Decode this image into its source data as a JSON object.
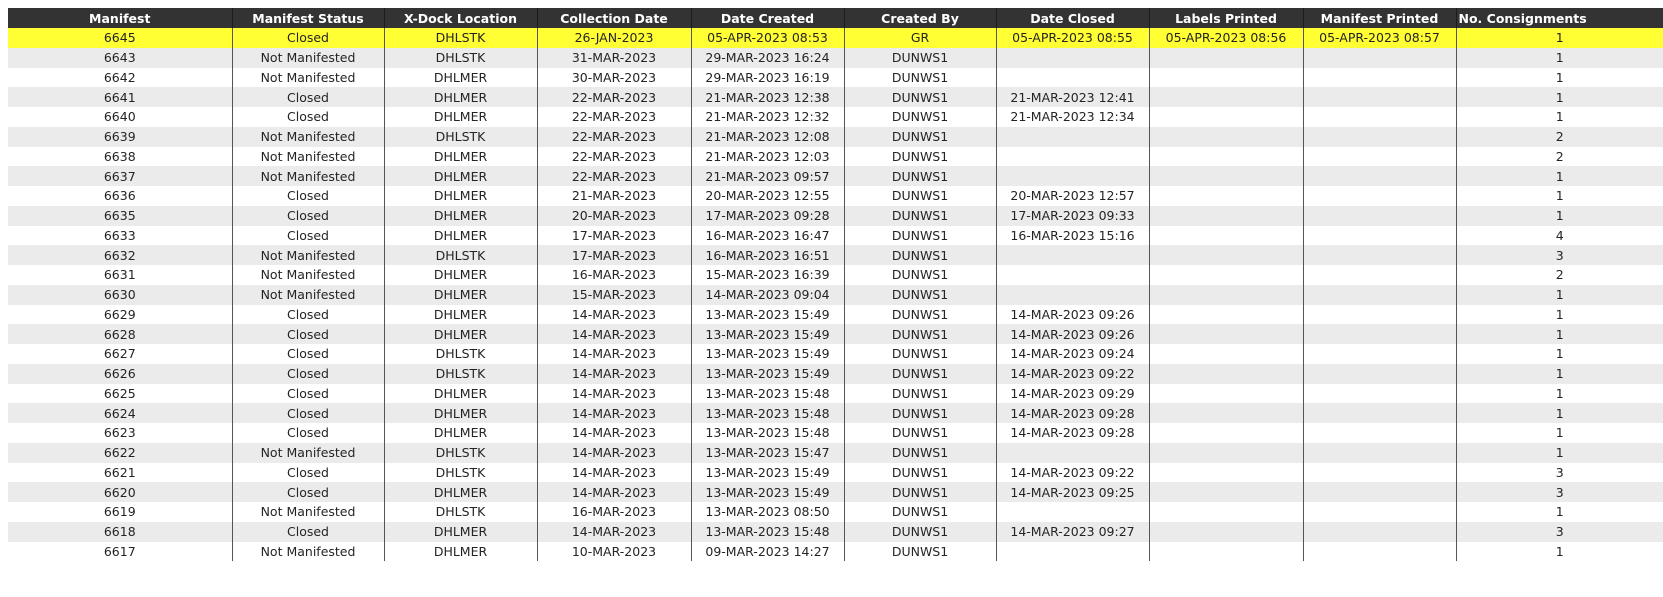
{
  "table": {
    "columns": [
      "Manifest",
      "Manifest Status",
      "X-Dock Location",
      "Collection Date",
      "Date Created",
      "Created By",
      "Date Closed",
      "Labels Printed",
      "Manifest Printed",
      "No. Consignments"
    ],
    "selected_row_index": 0,
    "colors": {
      "header_bg": "#333333",
      "header_text": "#ffffff",
      "row_alt_bg": "#ebebeb",
      "row_bg": "#ffffff",
      "selected_bg": "#ffff33"
    },
    "rows": [
      [
        "6645",
        "Closed",
        "DHLSTK",
        "26-JAN-2023",
        "05-APR-2023 08:53",
        "GR",
        "05-APR-2023 08:55",
        "05-APR-2023 08:56",
        "05-APR-2023 08:57",
        "1"
      ],
      [
        "6643",
        "Not Manifested",
        "DHLSTK",
        "31-MAR-2023",
        "29-MAR-2023 16:24",
        "DUNWS1",
        "",
        "",
        "",
        "1"
      ],
      [
        "6642",
        "Not Manifested",
        "DHLMER",
        "30-MAR-2023",
        "29-MAR-2023 16:19",
        "DUNWS1",
        "",
        "",
        "",
        "1"
      ],
      [
        "6641",
        "Closed",
        "DHLMER",
        "22-MAR-2023",
        "21-MAR-2023 12:38",
        "DUNWS1",
        "21-MAR-2023 12:41",
        "",
        "",
        "1"
      ],
      [
        "6640",
        "Closed",
        "DHLMER",
        "22-MAR-2023",
        "21-MAR-2023 12:32",
        "DUNWS1",
        "21-MAR-2023 12:34",
        "",
        "",
        "1"
      ],
      [
        "6639",
        "Not Manifested",
        "DHLSTK",
        "22-MAR-2023",
        "21-MAR-2023 12:08",
        "DUNWS1",
        "",
        "",
        "",
        "2"
      ],
      [
        "6638",
        "Not Manifested",
        "DHLMER",
        "22-MAR-2023",
        "21-MAR-2023 12:03",
        "DUNWS1",
        "",
        "",
        "",
        "2"
      ],
      [
        "6637",
        "Not Manifested",
        "DHLMER",
        "22-MAR-2023",
        "21-MAR-2023 09:57",
        "DUNWS1",
        "",
        "",
        "",
        "1"
      ],
      [
        "6636",
        "Closed",
        "DHLMER",
        "21-MAR-2023",
        "20-MAR-2023 12:55",
        "DUNWS1",
        "20-MAR-2023 12:57",
        "",
        "",
        "1"
      ],
      [
        "6635",
        "Closed",
        "DHLMER",
        "20-MAR-2023",
        "17-MAR-2023 09:28",
        "DUNWS1",
        "17-MAR-2023 09:33",
        "",
        "",
        "1"
      ],
      [
        "6633",
        "Closed",
        "DHLMER",
        "17-MAR-2023",
        "16-MAR-2023 16:47",
        "DUNWS1",
        "16-MAR-2023 15:16",
        "",
        "",
        "4"
      ],
      [
        "6632",
        "Not Manifested",
        "DHLSTK",
        "17-MAR-2023",
        "16-MAR-2023 16:51",
        "DUNWS1",
        "",
        "",
        "",
        "3"
      ],
      [
        "6631",
        "Not Manifested",
        "DHLMER",
        "16-MAR-2023",
        "15-MAR-2023 16:39",
        "DUNWS1",
        "",
        "",
        "",
        "2"
      ],
      [
        "6630",
        "Not Manifested",
        "DHLMER",
        "15-MAR-2023",
        "14-MAR-2023 09:04",
        "DUNWS1",
        "",
        "",
        "",
        "1"
      ],
      [
        "6629",
        "Closed",
        "DHLMER",
        "14-MAR-2023",
        "13-MAR-2023 15:49",
        "DUNWS1",
        "14-MAR-2023 09:26",
        "",
        "",
        "1"
      ],
      [
        "6628",
        "Closed",
        "DHLMER",
        "14-MAR-2023",
        "13-MAR-2023 15:49",
        "DUNWS1",
        "14-MAR-2023 09:26",
        "",
        "",
        "1"
      ],
      [
        "6627",
        "Closed",
        "DHLSTK",
        "14-MAR-2023",
        "13-MAR-2023 15:49",
        "DUNWS1",
        "14-MAR-2023 09:24",
        "",
        "",
        "1"
      ],
      [
        "6626",
        "Closed",
        "DHLSTK",
        "14-MAR-2023",
        "13-MAR-2023 15:49",
        "DUNWS1",
        "14-MAR-2023 09:22",
        "",
        "",
        "1"
      ],
      [
        "6625",
        "Closed",
        "DHLMER",
        "14-MAR-2023",
        "13-MAR-2023 15:48",
        "DUNWS1",
        "14-MAR-2023 09:29",
        "",
        "",
        "1"
      ],
      [
        "6624",
        "Closed",
        "DHLMER",
        "14-MAR-2023",
        "13-MAR-2023 15:48",
        "DUNWS1",
        "14-MAR-2023 09:28",
        "",
        "",
        "1"
      ],
      [
        "6623",
        "Closed",
        "DHLMER",
        "14-MAR-2023",
        "13-MAR-2023 15:48",
        "DUNWS1",
        "14-MAR-2023 09:28",
        "",
        "",
        "1"
      ],
      [
        "6622",
        "Not Manifested",
        "DHLSTK",
        "14-MAR-2023",
        "13-MAR-2023 15:47",
        "DUNWS1",
        "",
        "",
        "",
        "1"
      ],
      [
        "6621",
        "Closed",
        "DHLSTK",
        "14-MAR-2023",
        "13-MAR-2023 15:49",
        "DUNWS1",
        "14-MAR-2023 09:22",
        "",
        "",
        "3"
      ],
      [
        "6620",
        "Closed",
        "DHLMER",
        "14-MAR-2023",
        "13-MAR-2023 15:49",
        "DUNWS1",
        "14-MAR-2023 09:25",
        "",
        "",
        "3"
      ],
      [
        "6619",
        "Not Manifested",
        "DHLSTK",
        "16-MAR-2023",
        "13-MAR-2023 08:50",
        "DUNWS1",
        "",
        "",
        "",
        "1"
      ],
      [
        "6618",
        "Closed",
        "DHLMER",
        "14-MAR-2023",
        "13-MAR-2023 15:48",
        "DUNWS1",
        "14-MAR-2023 09:27",
        "",
        "",
        "3"
      ],
      [
        "6617",
        "Not Manifested",
        "DHLMER",
        "10-MAR-2023",
        "09-MAR-2023 14:27",
        "DUNWS1",
        "",
        "",
        "",
        "1"
      ]
    ]
  }
}
